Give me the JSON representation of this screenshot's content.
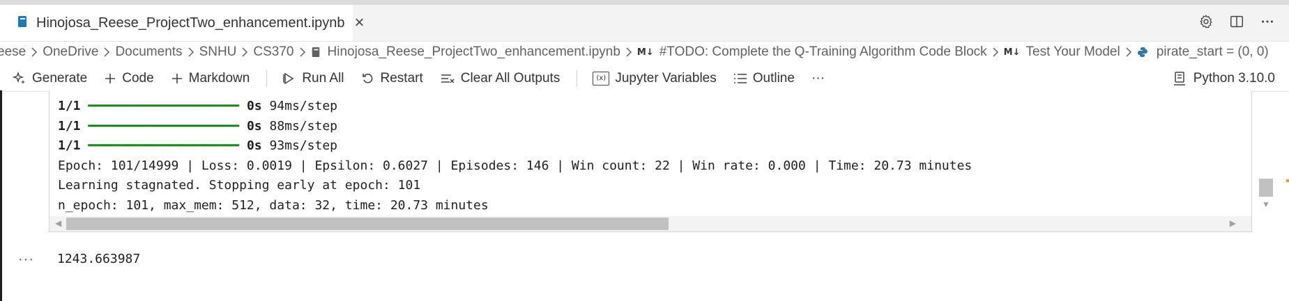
{
  "tab": {
    "title": "Hinojosa_Reese_ProjectTwo_enhancement.ipynb",
    "close": "×"
  },
  "breadcrumb": {
    "items": [
      "eese",
      "OneDrive",
      "Documents",
      "SNHU",
      "CS370",
      "Hinojosa_Reese_ProjectTwo_enhancement.ipynb",
      "#TODO: Complete the Q-Training Algorithm Code Block",
      "Test Your Model",
      "pirate_start = (0, 0)"
    ],
    "md_badge": "M↓"
  },
  "toolbar": {
    "generate": "Generate",
    "code": "Code",
    "markdown": "Markdown",
    "run_all": "Run All",
    "restart": "Restart",
    "clear_outputs": "Clear All Outputs",
    "variables": "Jupyter Variables",
    "outline": "Outline",
    "more": "···",
    "kernel": "Python 3.10.0",
    "variables_badge": "(x)"
  },
  "output": {
    "progress_lines": [
      {
        "count": "1/1",
        "bar": "━━━━━━━━━━━━━━━━━━━━",
        "time": "0s",
        "rate": "94ms/step"
      },
      {
        "count": "1/1",
        "bar": "━━━━━━━━━━━━━━━━━━━━",
        "time": "0s",
        "rate": "88ms/step"
      },
      {
        "count": "1/1",
        "bar": "━━━━━━━━━━━━━━━━━━━━",
        "time": "0s",
        "rate": "93ms/step"
      }
    ],
    "epoch_line": "Epoch: 101/14999 | Loss: 0.0019 | Epsilon: 0.6027 | Episodes: 146 | Win count: 22 | Win rate: 0.000 | Time: 20.73 minutes",
    "stagnated_line": "Learning stagnated. Stopping early at epoch: 101",
    "summary_line": "n_epoch: 101, max_mem: 512, data: 32, time: 20.73 minutes"
  },
  "cell": {
    "exec_indicator": "···",
    "result": "1243.663987"
  }
}
